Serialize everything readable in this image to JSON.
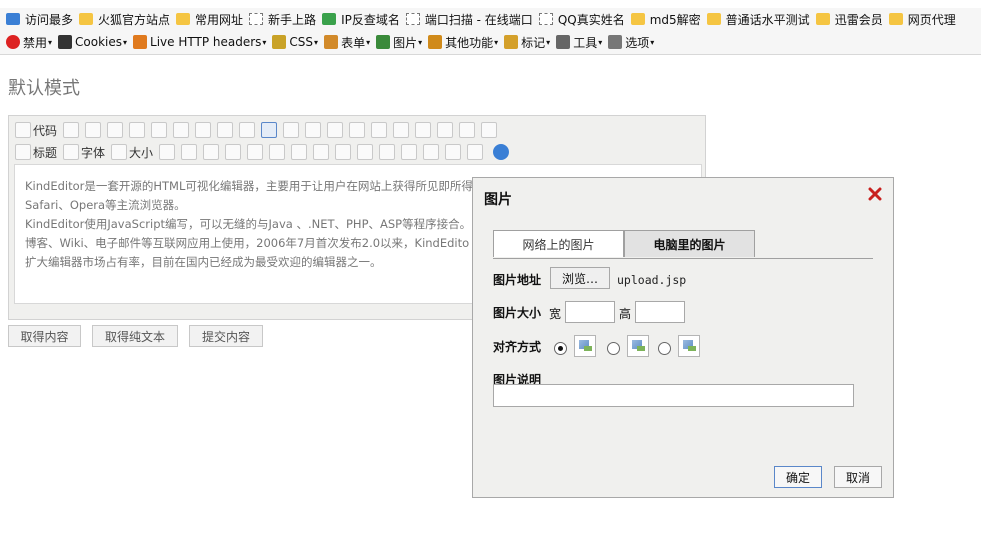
{
  "bookmarks": [
    {
      "label": "访问最多",
      "icon": "search-icon"
    },
    {
      "label": "火狐官方站点",
      "icon": "folder-icon"
    },
    {
      "label": "常用网址",
      "icon": "folder-icon"
    },
    {
      "label": "新手上路",
      "icon": "page-icon"
    },
    {
      "label": "IP反查域名",
      "icon": "globe-icon"
    },
    {
      "label": "端口扫描 - 在线端口",
      "icon": "page-icon"
    },
    {
      "label": "QQ真实姓名",
      "icon": "page-icon"
    },
    {
      "label": "md5解密",
      "icon": "folder-icon"
    },
    {
      "label": "普通话水平测试",
      "icon": "folder-icon"
    },
    {
      "label": "迅雷会员",
      "icon": "folder-icon"
    },
    {
      "label": "网页代理",
      "icon": "folder-icon"
    }
  ],
  "devbar": [
    {
      "label": "禁用",
      "icon": "disable-icon",
      "color": "#d22"
    },
    {
      "label": "Cookies",
      "icon": "cookie-icon",
      "color": "#333"
    },
    {
      "label": "Live HTTP headers",
      "icon": "headers-icon",
      "color": "#e07a1e"
    },
    {
      "label": "CSS",
      "icon": "css-icon",
      "color": "#c9a227"
    },
    {
      "label": "表单",
      "icon": "form-icon",
      "color": "#d28a2a"
    },
    {
      "label": "图片",
      "icon": "image-icon",
      "color": "#3a8a3a"
    },
    {
      "label": "其他功能",
      "icon": "misc-icon",
      "color": "#d08a1a"
    },
    {
      "label": "标记",
      "icon": "pencil-icon",
      "color": "#d4a02a"
    },
    {
      "label": "工具",
      "icon": "tools-icon",
      "color": "#666"
    },
    {
      "label": "选项",
      "icon": "options-icon",
      "color": "#777"
    }
  ],
  "page": {
    "title": "默认模式"
  },
  "toolbar": {
    "code_label": "代码",
    "title_label": "标题",
    "font_label": "字体",
    "size_label": "大小"
  },
  "editor": {
    "lines": [
      "KindEditor是一套开源的HTML可视化编辑器，主要用于让用户在网站上获得所见即所得",
      "Safari、Opera等主流浏览器。",
      "KindEditor使用JavaScript编写，可以无缝的与Java 、.NET、PHP、ASP等程序接合。K",
      "博客、Wiki、电子邮件等互联网应用上使用，2006年7月首次发布2.0以来，KindEdito",
      "扩大编辑器市场占有率，目前在国内已经成为最受欢迎的编辑器之一。"
    ]
  },
  "buttons": {
    "get_html": "取得内容",
    "get_text": "取得纯文本",
    "submit": "提交内容"
  },
  "dialog": {
    "title": "图片",
    "tabs": [
      {
        "label": "网络上的图片",
        "active": false
      },
      {
        "label": "电脑里的图片",
        "active": true
      }
    ],
    "file_label": "图片地址",
    "browse_label": "浏览…",
    "file_value": "upload.jsp",
    "size_label": "图片大小",
    "width_label": "宽",
    "height_label": "高",
    "align_label": "对齐方式",
    "desc_label": "图片说明",
    "ok_label": "确定",
    "cancel_label": "取消"
  }
}
